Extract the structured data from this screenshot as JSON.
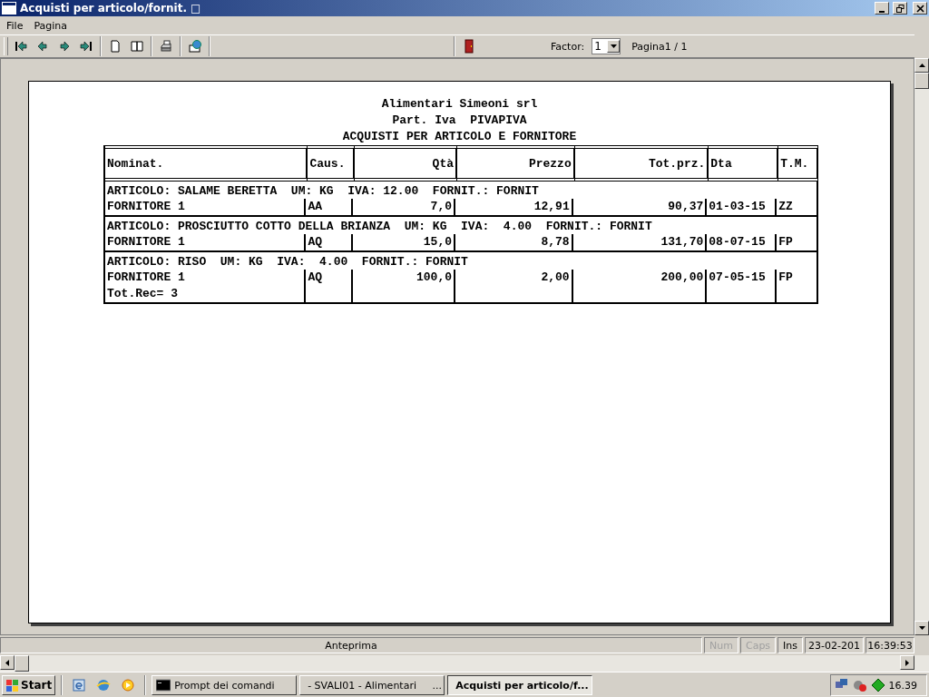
{
  "window": {
    "title": "Acquisti per articolo/fornit. □"
  },
  "menu": [
    "File",
    "Pagina"
  ],
  "toolbar": {
    "factor_label": "Factor:",
    "factor": "1",
    "page_label": "Pagina1 / 1"
  },
  "report": {
    "heading": [
      "Alimentari Simeoni srl",
      "Part. Iva  PIVAPIVA",
      "ACQUISTI PER ARTICOLO E FORNITORE"
    ],
    "columns": [
      {
        "label": "Nominat.",
        "kind": "text"
      },
      {
        "label": "Caus.",
        "kind": "text"
      },
      {
        "label": "Qtà",
        "kind": "number"
      },
      {
        "label": "Prezzo",
        "kind": "number"
      },
      {
        "label": "Tot.prz.",
        "kind": "number"
      },
      {
        "label": "Dta",
        "kind": "text"
      },
      {
        "label": "T.M.",
        "kind": "text"
      }
    ],
    "groups": [
      {
        "article": "ARTICOLO: SALAME BERETTA  UM: KG  IVA: 12.00  FORNIT.: FORNIT",
        "cells": [
          "FORNITORE 1",
          "AA",
          "7,0",
          "12,91",
          "90,37",
          "01-03-15",
          "ZZ"
        ]
      },
      {
        "article": "ARTICOLO: PROSCIUTTO COTTO DELLA BRIANZA  UM: KG  IVA:  4.00  FORNIT.: FORNIT",
        "cells": [
          "FORNITORE 1",
          "AQ",
          "15,0",
          "8,78",
          "131,70",
          "08-07-15",
          "FP"
        ]
      },
      {
        "article": "ARTICOLO: RISO  UM: KG  IVA:  4.00  FORNIT.: FORNIT",
        "cells": [
          "FORNITORE 1",
          "AQ",
          "100,0",
          "2,00",
          "200,00",
          "07-05-15",
          "FP"
        ]
      }
    ],
    "total": "Tot.Rec= 3"
  },
  "status_bar": {
    "message": "Anteprima",
    "indicators": [
      {
        "label": "Num",
        "on": false
      },
      {
        "label": "Caps",
        "on": false
      },
      {
        "label": "Ins",
        "on": true
      }
    ],
    "date": "23-02-201",
    "time": "16:39:53"
  },
  "taskbar": {
    "start": "Start",
    "tasks": [
      {
        "label": "Prompt dei comandi",
        "selected": false
      },
      {
        "label": "- SVALI01 - Alimentari     ...",
        "selected": false
      },
      {
        "label": "Acquisti per articolo/f...",
        "selected": true
      }
    ],
    "clock": "16.39"
  }
}
